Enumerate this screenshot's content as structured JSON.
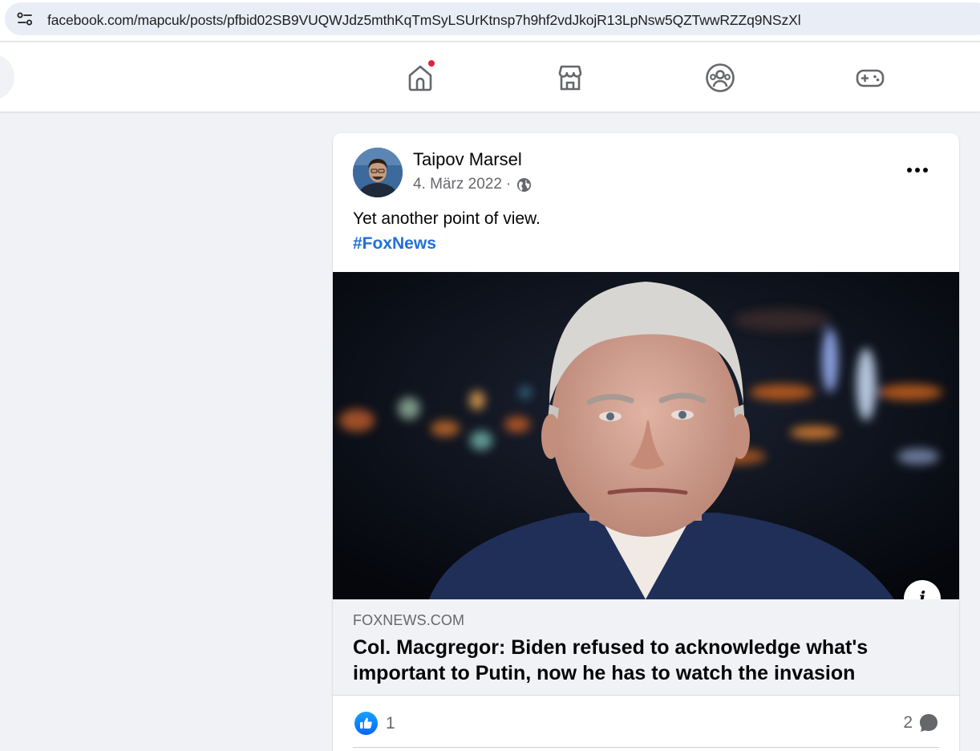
{
  "browser": {
    "url": "facebook.com/mapcuk/posts/pfbid02SB9VUQWJdz5mthKqTmSyLSUrKtnsp7h9hf2vdJkojR13LpNsw5QZTwwRZZq9NSzXl"
  },
  "nav": {
    "tabs": [
      {
        "icon": "home-icon",
        "has_notification": true
      },
      {
        "icon": "marketplace-icon",
        "has_notification": false
      },
      {
        "icon": "groups-icon",
        "has_notification": false
      },
      {
        "icon": "gaming-icon",
        "has_notification": false
      }
    ]
  },
  "post": {
    "author": "Taipov Marsel",
    "date": "4. März 2022",
    "separator": "·",
    "audience_icon": "globe-icon",
    "text": "Yet another point of view.",
    "hashtag": "#FoxNews",
    "link": {
      "domain": "FOXNEWS.COM",
      "title": "Col. Macgregor: Biden refused to acknowledge what's important to Putin, now he has to watch the invasion"
    },
    "likes": "1",
    "comments": "2"
  },
  "colors": {
    "accent": "#216fdb",
    "like_blue": "#0866ff",
    "notification_red": "#e41e3f",
    "meta_gray": "#65676b"
  }
}
